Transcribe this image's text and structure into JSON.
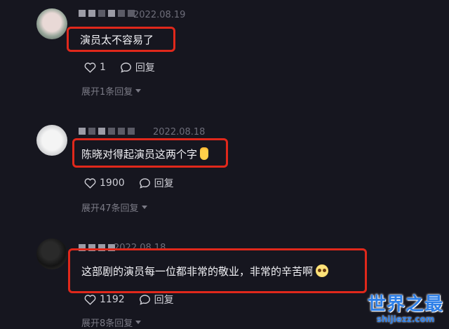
{
  "comments": [
    {
      "date": "2022.08.19",
      "text": "演员太不容易了",
      "likes": "1",
      "reply_label": "回复",
      "expand": "展开1条回复"
    },
    {
      "date": "2022.08.18",
      "text": "陈晓对得起演员这两个字",
      "emoji": "flexed-biceps-emoji",
      "likes": "1900",
      "reply_label": "回复",
      "expand": "展开47条回复"
    },
    {
      "date": "2022.08.18",
      "text": "这部剧的演员每一位都非常的敬业，非常的辛苦啊",
      "emoji": "pleading-face-emoji",
      "likes": "1192",
      "reply_label": "回复",
      "expand": "展开8条回复"
    }
  ],
  "watermark": {
    "main": "世界之最",
    "sub": "shijiezz.com"
  },
  "colors": {
    "background": "#16161f",
    "highlight_box": "#e0281b",
    "watermark": "#2d7fe8"
  }
}
